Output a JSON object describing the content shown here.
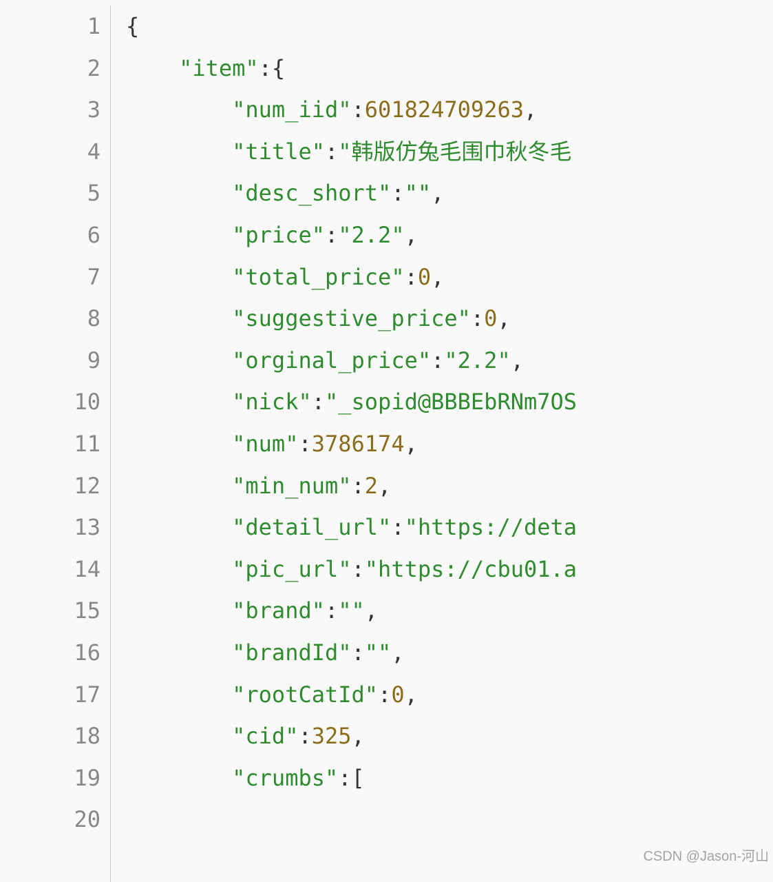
{
  "watermark": "CSDN @Jason-河山",
  "code": {
    "indent": "    ",
    "lines": [
      {
        "n": 1,
        "depth": 0,
        "tokens": [
          {
            "t": "punc",
            "v": "{"
          }
        ]
      },
      {
        "n": 2,
        "depth": 1,
        "tokens": [
          {
            "t": "key",
            "v": "\"item\""
          },
          {
            "t": "punc",
            "v": ":{"
          }
        ]
      },
      {
        "n": 3,
        "depth": 2,
        "tokens": [
          {
            "t": "key",
            "v": "\"num_iid\""
          },
          {
            "t": "punc",
            "v": ":"
          },
          {
            "t": "num",
            "v": "601824709263"
          },
          {
            "t": "punc",
            "v": ","
          }
        ]
      },
      {
        "n": 4,
        "depth": 2,
        "tokens": [
          {
            "t": "key",
            "v": "\"title\""
          },
          {
            "t": "punc",
            "v": ":"
          },
          {
            "t": "str",
            "v": "\"韩版仿兔毛围巾秋冬毛"
          }
        ]
      },
      {
        "n": 5,
        "depth": 2,
        "tokens": [
          {
            "t": "key",
            "v": "\"desc_short\""
          },
          {
            "t": "punc",
            "v": ":"
          },
          {
            "t": "str",
            "v": "\"\""
          },
          {
            "t": "punc",
            "v": ","
          }
        ]
      },
      {
        "n": 6,
        "depth": 2,
        "tokens": [
          {
            "t": "key",
            "v": "\"price\""
          },
          {
            "t": "punc",
            "v": ":"
          },
          {
            "t": "str",
            "v": "\"2.2\""
          },
          {
            "t": "punc",
            "v": ","
          }
        ]
      },
      {
        "n": 7,
        "depth": 2,
        "tokens": [
          {
            "t": "key",
            "v": "\"total_price\""
          },
          {
            "t": "punc",
            "v": ":"
          },
          {
            "t": "num",
            "v": "0"
          },
          {
            "t": "punc",
            "v": ","
          }
        ]
      },
      {
        "n": 8,
        "depth": 2,
        "tokens": [
          {
            "t": "key",
            "v": "\"suggestive_price\""
          },
          {
            "t": "punc",
            "v": ":"
          },
          {
            "t": "num",
            "v": "0"
          },
          {
            "t": "punc",
            "v": ","
          }
        ]
      },
      {
        "n": 9,
        "depth": 2,
        "tokens": [
          {
            "t": "key",
            "v": "\"orginal_price\""
          },
          {
            "t": "punc",
            "v": ":"
          },
          {
            "t": "str",
            "v": "\"2.2\""
          },
          {
            "t": "punc",
            "v": ","
          }
        ]
      },
      {
        "n": 10,
        "depth": 2,
        "tokens": [
          {
            "t": "key",
            "v": "\"nick\""
          },
          {
            "t": "punc",
            "v": ":"
          },
          {
            "t": "str",
            "v": "\"_sopid@BBBEbRNm7OS"
          }
        ]
      },
      {
        "n": 11,
        "depth": 2,
        "tokens": [
          {
            "t": "key",
            "v": "\"num\""
          },
          {
            "t": "punc",
            "v": ":"
          },
          {
            "t": "num",
            "v": "3786174"
          },
          {
            "t": "punc",
            "v": ","
          }
        ]
      },
      {
        "n": 12,
        "depth": 2,
        "tokens": [
          {
            "t": "key",
            "v": "\"min_num\""
          },
          {
            "t": "punc",
            "v": ":"
          },
          {
            "t": "num",
            "v": "2"
          },
          {
            "t": "punc",
            "v": ","
          }
        ]
      },
      {
        "n": 13,
        "depth": 2,
        "tokens": [
          {
            "t": "key",
            "v": "\"detail_url\""
          },
          {
            "t": "punc",
            "v": ":"
          },
          {
            "t": "str",
            "v": "\"https://deta"
          }
        ]
      },
      {
        "n": 14,
        "depth": 2,
        "tokens": [
          {
            "t": "key",
            "v": "\"pic_url\""
          },
          {
            "t": "punc",
            "v": ":"
          },
          {
            "t": "str",
            "v": "\"https://cbu01.a"
          }
        ]
      },
      {
        "n": 15,
        "depth": 2,
        "tokens": [
          {
            "t": "key",
            "v": "\"brand\""
          },
          {
            "t": "punc",
            "v": ":"
          },
          {
            "t": "str",
            "v": "\"\""
          },
          {
            "t": "punc",
            "v": ","
          }
        ]
      },
      {
        "n": 16,
        "depth": 2,
        "tokens": [
          {
            "t": "key",
            "v": "\"brandId\""
          },
          {
            "t": "punc",
            "v": ":"
          },
          {
            "t": "str",
            "v": "\"\""
          },
          {
            "t": "punc",
            "v": ","
          }
        ]
      },
      {
        "n": 17,
        "depth": 2,
        "tokens": [
          {
            "t": "key",
            "v": "\"rootCatId\""
          },
          {
            "t": "punc",
            "v": ":"
          },
          {
            "t": "num",
            "v": "0"
          },
          {
            "t": "punc",
            "v": ","
          }
        ]
      },
      {
        "n": 18,
        "depth": 2,
        "tokens": [
          {
            "t": "key",
            "v": "\"cid\""
          },
          {
            "t": "punc",
            "v": ":"
          },
          {
            "t": "num",
            "v": "325"
          },
          {
            "t": "punc",
            "v": ","
          }
        ]
      },
      {
        "n": 19,
        "depth": 2,
        "tokens": [
          {
            "t": "key",
            "v": "\"crumbs\""
          },
          {
            "t": "punc",
            "v": ":["
          }
        ]
      },
      {
        "n": 20,
        "depth": 2,
        "tokens": []
      }
    ]
  }
}
